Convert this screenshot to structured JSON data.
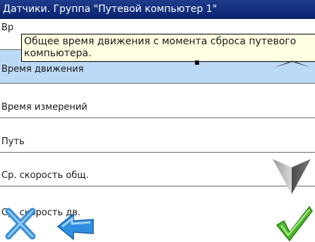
{
  "window": {
    "title": "Датчики. Группа \"Путевой компьютер 1\""
  },
  "tooltip": {
    "text": "Общее время движения с момента сброса путевого компьютера."
  },
  "rows": [
    {
      "label": "Вр"
    },
    {
      "label": "Время движения"
    },
    {
      "label": "Время измерений"
    },
    {
      "label": "Путь"
    },
    {
      "label": "Ср. скорость общ."
    },
    {
      "label": "Ср. скорость дв."
    }
  ],
  "icons": {
    "close": "close-icon",
    "back": "back-arrow-icon",
    "ok": "checkmark-icon",
    "scroll_down": "scroll-down-arrow-icon"
  }
}
